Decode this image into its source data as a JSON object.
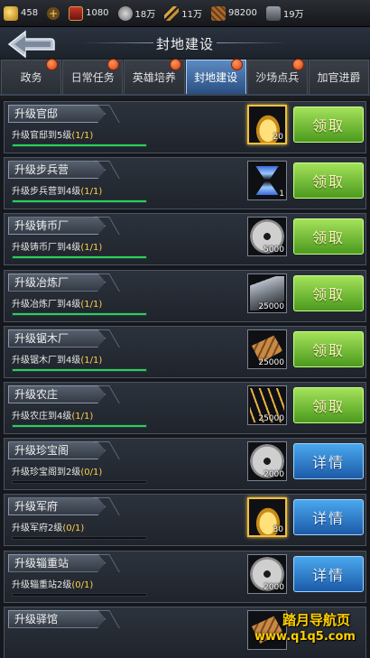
{
  "resources": [
    {
      "icon": "gold-icon",
      "value": "458"
    },
    {
      "icon": "plus-icon",
      "value": ""
    },
    {
      "icon": "rank-shield-icon",
      "value": "1080"
    },
    {
      "icon": "coin-icon",
      "value": "18万"
    },
    {
      "icon": "grain-icon",
      "value": "11万"
    },
    {
      "icon": "wood-icon",
      "value": "98200"
    },
    {
      "icon": "iron-icon",
      "value": "19万"
    }
  ],
  "header": {
    "title": "封地建设"
  },
  "tabs": [
    {
      "label": "政务",
      "badge": true,
      "active": false
    },
    {
      "label": "日常任务",
      "badge": true,
      "active": false
    },
    {
      "label": "英雄培养",
      "badge": true,
      "active": false
    },
    {
      "label": "封地建设",
      "badge": true,
      "active": true
    },
    {
      "label": "沙场点兵",
      "badge": true,
      "active": false
    },
    {
      "label": "加官进爵",
      "badge": false,
      "active": false
    }
  ],
  "tasks": [
    {
      "title": "升级官邸",
      "desc": "升级官邸到5级",
      "progress_text": "(1/1)",
      "progress": 1.0,
      "reward_icon": "gold-ingot-icon",
      "reward_amount": "20",
      "reward_frame": "gold",
      "button": "领取",
      "button_type": "claim"
    },
    {
      "title": "升级步兵营",
      "desc": "升级步兵营到4级",
      "progress_text": "(1/1)",
      "progress": 1.0,
      "reward_icon": "hourglass-icon",
      "reward_amount": "1",
      "reward_frame": "normal",
      "button": "领取",
      "button_type": "claim"
    },
    {
      "title": "升级铸币厂",
      "desc": "升级铸币厂到4级",
      "progress_text": "(1/1)",
      "progress": 1.0,
      "reward_icon": "coin-icon",
      "reward_amount": "5000",
      "reward_frame": "normal",
      "button": "领取",
      "button_type": "claim"
    },
    {
      "title": "升级冶炼厂",
      "desc": "升级冶炼厂到4级",
      "progress_text": "(1/1)",
      "progress": 1.0,
      "reward_icon": "iron-icon",
      "reward_amount": "25000",
      "reward_frame": "normal",
      "button": "领取",
      "button_type": "claim"
    },
    {
      "title": "升级锯木厂",
      "desc": "升级锯木厂到4级",
      "progress_text": "(1/1)",
      "progress": 1.0,
      "reward_icon": "wood-icon",
      "reward_amount": "25000",
      "reward_frame": "normal",
      "button": "领取",
      "button_type": "claim"
    },
    {
      "title": "升级农庄",
      "desc": "升级农庄到4级",
      "progress_text": "(1/1)",
      "progress": 1.0,
      "reward_icon": "wheat-icon",
      "reward_amount": "25000",
      "reward_frame": "normal",
      "button": "领取",
      "button_type": "claim"
    },
    {
      "title": "升级珍宝阁",
      "desc": "升级珍宝阁到2级",
      "progress_text": "(0/1)",
      "progress": 0.0,
      "reward_icon": "coin-icon",
      "reward_amount": "2000",
      "reward_frame": "normal",
      "button": "详情",
      "button_type": "detail"
    },
    {
      "title": "升级军府",
      "desc": "升级军府2级",
      "progress_text": "(0/1)",
      "progress": 0.0,
      "reward_icon": "gold-ingot-icon",
      "reward_amount": "30",
      "reward_frame": "gold",
      "button": "详情",
      "button_type": "detail"
    },
    {
      "title": "升级辎重站",
      "desc": "升级辎重站2级",
      "progress_text": "(0/1)",
      "progress": 0.0,
      "reward_icon": "coin-icon",
      "reward_amount": "2000",
      "reward_frame": "normal",
      "button": "详情",
      "button_type": "detail"
    },
    {
      "title": "升级驿馆",
      "desc": "",
      "progress_text": "",
      "progress": 0.0,
      "reward_icon": "wood-icon",
      "reward_amount": "",
      "reward_frame": "normal",
      "button": "",
      "button_type": "detail"
    }
  ],
  "watermark": {
    "line1": "踏月导航页",
    "line2": "www.q1q5.com"
  },
  "colors": {
    "claim": "#6ab830",
    "detail": "#2a78c8",
    "progress": "#24d35a",
    "active_tab": "#3e6aa0",
    "level_highlight": "#ffd04a"
  }
}
